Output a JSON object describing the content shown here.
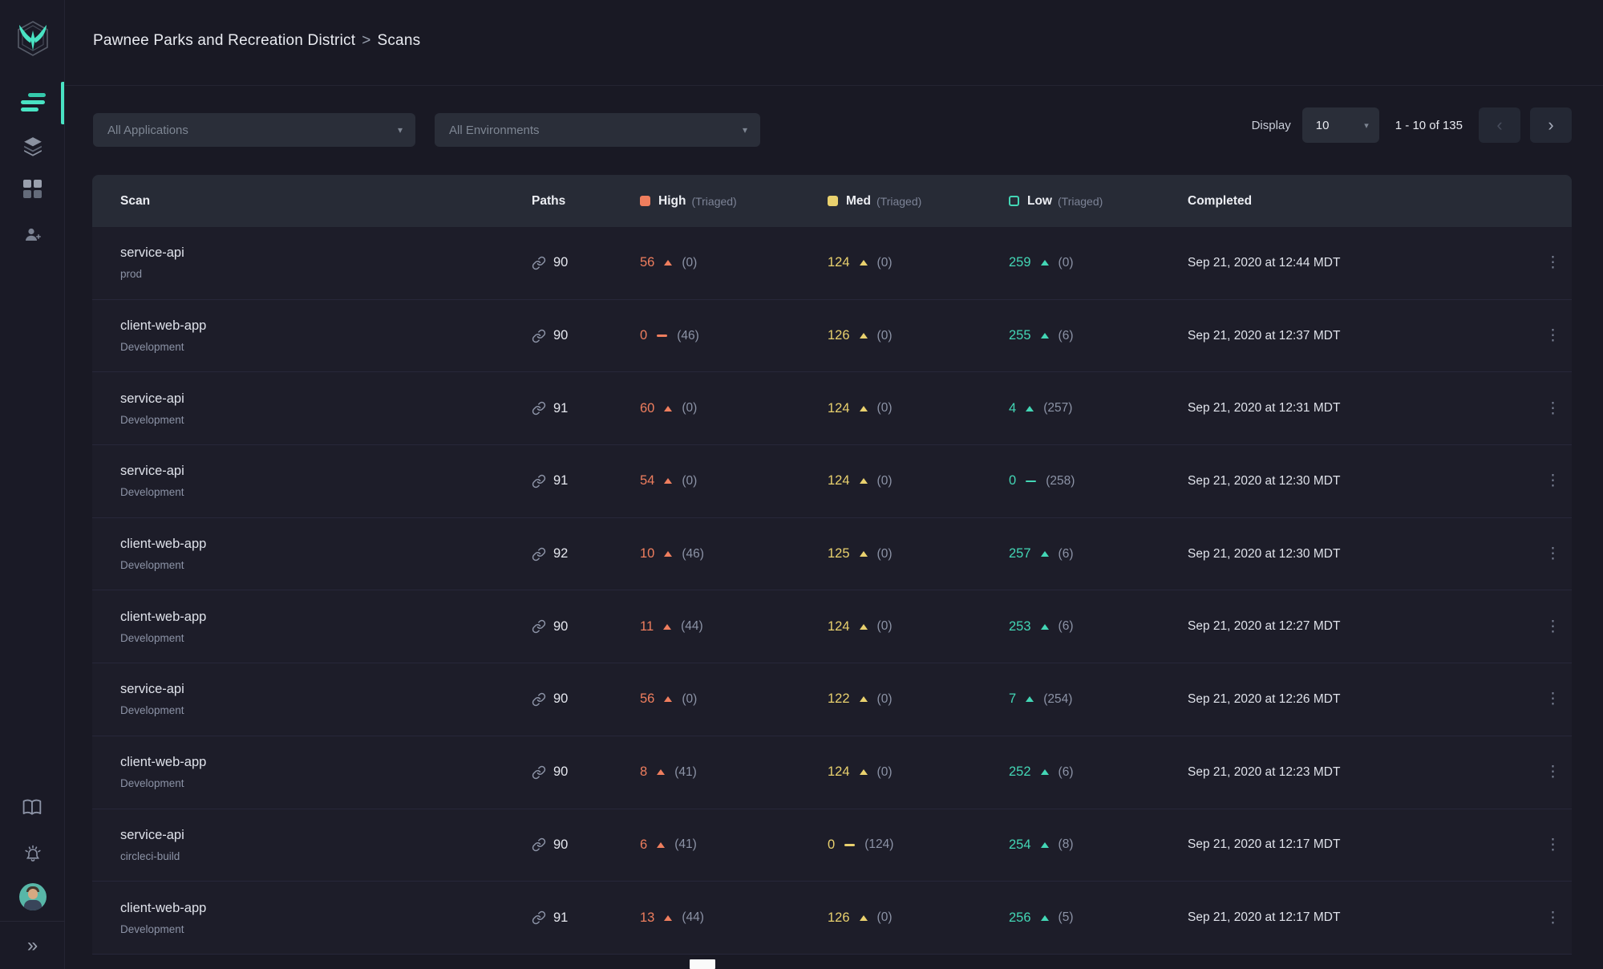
{
  "header": {
    "breadcrumb_org": "Pawnee Parks and Recreation District",
    "breadcrumb_sep": ">",
    "breadcrumb_page": "Scans"
  },
  "toolbar": {
    "app_filter": "All Applications",
    "env_filter": "All Environments",
    "display_label": "Display",
    "page_size": "10",
    "range_text": "1 - 10 of 135"
  },
  "icons": {
    "dropdown_caret": "▾",
    "prev_chevron": "‹",
    "next_chevron": "›",
    "collapse_chevrons": "»",
    "menu_dots": "⋮"
  },
  "table": {
    "col_scan": "Scan",
    "col_paths": "Paths",
    "col_high": "High",
    "col_med": "Med",
    "col_low": "Low",
    "triaged_label": "(Triaged)",
    "col_completed": "Completed",
    "rows": [
      {
        "name": "service-api",
        "env": "prod",
        "paths": "90",
        "high": {
          "value": "56",
          "trend": "up",
          "triaged": "(0)"
        },
        "med": {
          "value": "124",
          "trend": "up",
          "triaged": "(0)"
        },
        "low": {
          "value": "259",
          "trend": "up",
          "triaged": "(0)"
        },
        "completed": "Sep 21, 2020 at 12:44 MDT"
      },
      {
        "name": "client-web-app",
        "env": "Development",
        "paths": "90",
        "high": {
          "value": "0",
          "trend": "flat",
          "triaged": "(46)"
        },
        "med": {
          "value": "126",
          "trend": "up",
          "triaged": "(0)"
        },
        "low": {
          "value": "255",
          "trend": "up",
          "triaged": "(6)"
        },
        "completed": "Sep 21, 2020 at 12:37 MDT"
      },
      {
        "name": "service-api",
        "env": "Development",
        "paths": "91",
        "high": {
          "value": "60",
          "trend": "up",
          "triaged": "(0)"
        },
        "med": {
          "value": "124",
          "trend": "up",
          "triaged": "(0)"
        },
        "low": {
          "value": "4",
          "trend": "up",
          "triaged": "(257)"
        },
        "completed": "Sep 21, 2020 at 12:31 MDT"
      },
      {
        "name": "service-api",
        "env": "Development",
        "paths": "91",
        "high": {
          "value": "54",
          "trend": "up",
          "triaged": "(0)"
        },
        "med": {
          "value": "124",
          "trend": "up",
          "triaged": "(0)"
        },
        "low": {
          "value": "0",
          "trend": "flat",
          "triaged": "(258)"
        },
        "completed": "Sep 21, 2020 at 12:30 MDT"
      },
      {
        "name": "client-web-app",
        "env": "Development",
        "paths": "92",
        "high": {
          "value": "10",
          "trend": "up",
          "triaged": "(46)"
        },
        "med": {
          "value": "125",
          "trend": "up",
          "triaged": "(0)"
        },
        "low": {
          "value": "257",
          "trend": "up",
          "triaged": "(6)"
        },
        "completed": "Sep 21, 2020 at 12:30 MDT"
      },
      {
        "name": "client-web-app",
        "env": "Development",
        "paths": "90",
        "high": {
          "value": "11",
          "trend": "up",
          "triaged": "(44)"
        },
        "med": {
          "value": "124",
          "trend": "up",
          "triaged": "(0)"
        },
        "low": {
          "value": "253",
          "trend": "up",
          "triaged": "(6)"
        },
        "completed": "Sep 21, 2020 at 12:27 MDT"
      },
      {
        "name": "service-api",
        "env": "Development",
        "paths": "90",
        "high": {
          "value": "56",
          "trend": "up",
          "triaged": "(0)"
        },
        "med": {
          "value": "122",
          "trend": "up",
          "triaged": "(0)"
        },
        "low": {
          "value": "7",
          "trend": "up",
          "triaged": "(254)"
        },
        "completed": "Sep 21, 2020 at 12:26 MDT"
      },
      {
        "name": "client-web-app",
        "env": "Development",
        "paths": "90",
        "high": {
          "value": "8",
          "trend": "up",
          "triaged": "(41)"
        },
        "med": {
          "value": "124",
          "trend": "up",
          "triaged": "(0)"
        },
        "low": {
          "value": "252",
          "trend": "up",
          "triaged": "(6)"
        },
        "completed": "Sep 21, 2020 at 12:23 MDT"
      },
      {
        "name": "service-api",
        "env": "circleci-build",
        "paths": "90",
        "high": {
          "value": "6",
          "trend": "up",
          "triaged": "(41)"
        },
        "med": {
          "value": "0",
          "trend": "flat",
          "triaged": "(124)"
        },
        "low": {
          "value": "254",
          "trend": "up",
          "triaged": "(8)"
        },
        "completed": "Sep 21, 2020 at 12:17 MDT"
      },
      {
        "name": "client-web-app",
        "env": "Development",
        "paths": "91",
        "high": {
          "value": "13",
          "trend": "up",
          "triaged": "(44)"
        },
        "med": {
          "value": "126",
          "trend": "up",
          "triaged": "(0)"
        },
        "low": {
          "value": "256",
          "trend": "up",
          "triaged": "(5)"
        },
        "completed": "Sep 21, 2020 at 12:17 MDT"
      }
    ]
  },
  "colors": {
    "accent_teal": "#49e3c3",
    "high": "#ef7e5e",
    "med": "#e9d16e",
    "low": "#43d6b5"
  }
}
